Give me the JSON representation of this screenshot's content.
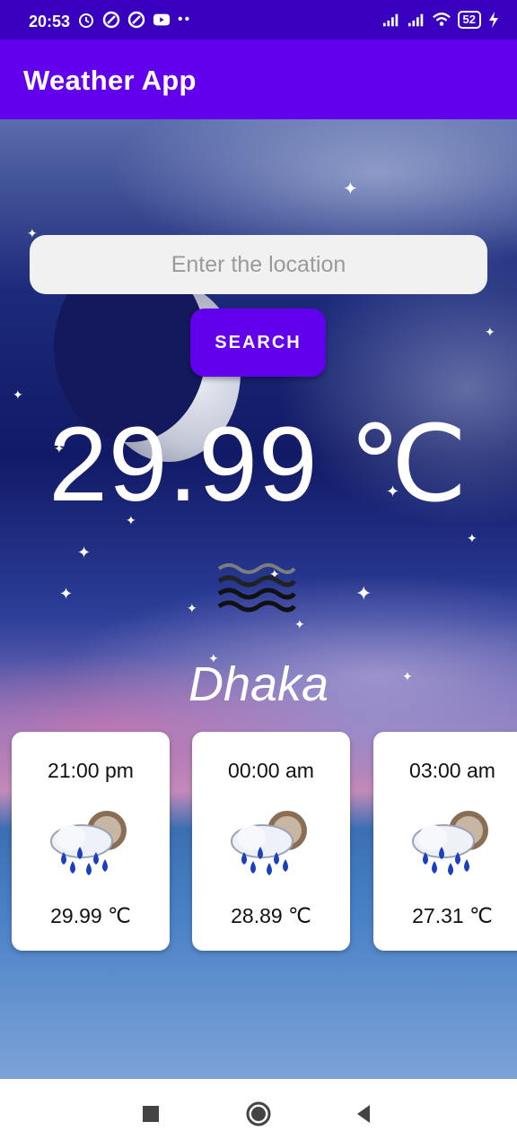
{
  "status_bar": {
    "time": "20:53",
    "battery": "52",
    "icons_left": [
      "alarm-icon",
      "app-icon",
      "app-icon",
      "youtube-icon"
    ],
    "icons_right": [
      "signal-icon",
      "signal-icon",
      "wifi-icon",
      "battery-icon",
      "charging-icon"
    ]
  },
  "app_bar": {
    "title": "Weather App"
  },
  "search": {
    "placeholder": "Enter the location",
    "value": "",
    "button_label": "SEARCH"
  },
  "current": {
    "temperature": "29.99 ℃",
    "condition_icon": "haze-icon",
    "city": "Dhaka"
  },
  "forecast": [
    {
      "time": "21:00 pm",
      "icon": "rain-night-icon",
      "temperature": "29.99 ℃"
    },
    {
      "time": "00:00 am",
      "icon": "rain-night-icon",
      "temperature": "28.89 ℃"
    },
    {
      "time": "03:00 am",
      "icon": "rain-night-icon",
      "temperature": "27.31 ℃"
    }
  ],
  "navigation": {
    "buttons": [
      "recent-apps",
      "home",
      "back"
    ]
  },
  "colors": {
    "primary": "#6200ee",
    "status_bar": "#3a00c0",
    "card": "#ffffff"
  }
}
